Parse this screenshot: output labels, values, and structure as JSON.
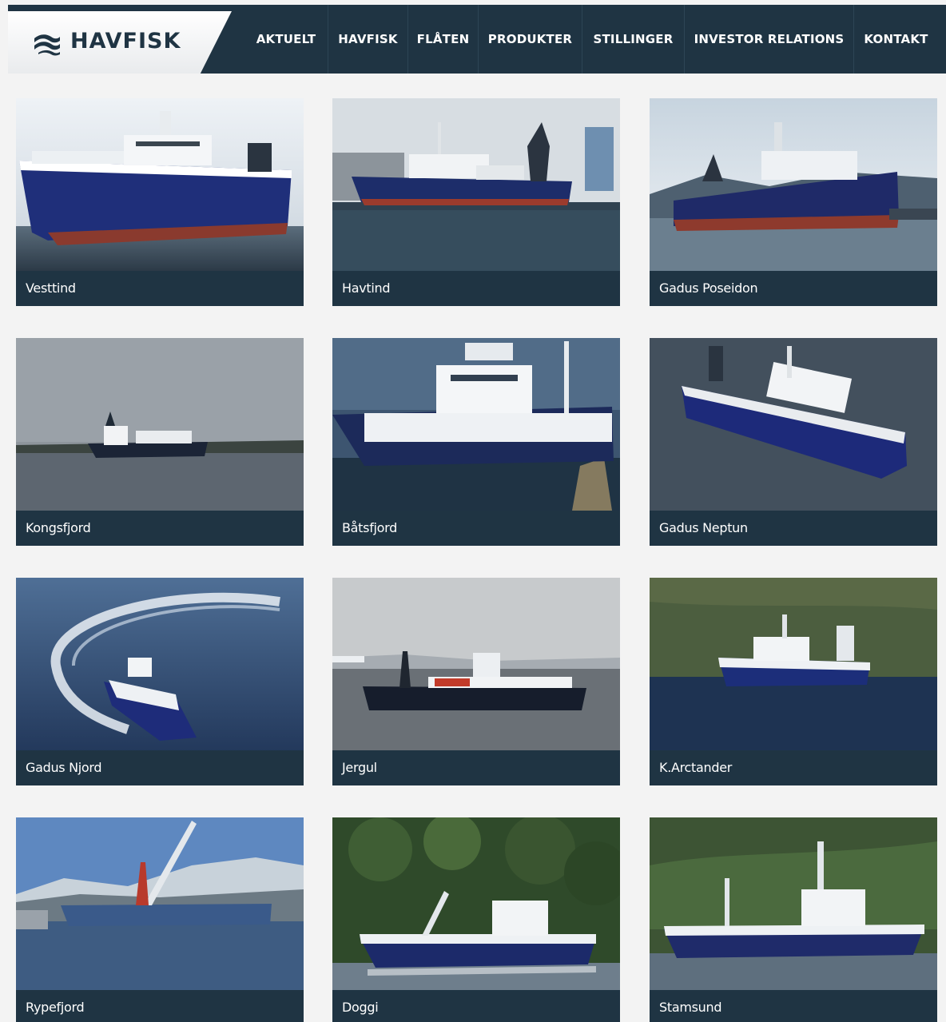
{
  "brand": {
    "name": "HAVFISK",
    "logo_icon": "wave-icon",
    "colors": {
      "navy": "#1f3443",
      "hull_blue": "#1f2f7a",
      "background": "#f3f3f3"
    }
  },
  "nav": {
    "items": [
      {
        "label": "AKTUELT"
      },
      {
        "label": "HAVFISK"
      },
      {
        "label": "FLÅTEN"
      },
      {
        "label": "PRODUKTER"
      },
      {
        "label": "STILLINGER"
      },
      {
        "label": "INVESTOR RELATIONS"
      },
      {
        "label": "KONTAKT"
      }
    ]
  },
  "fleet": {
    "vessels": [
      {
        "name": "Vesttind"
      },
      {
        "name": "Havtind"
      },
      {
        "name": "Gadus Poseidon"
      },
      {
        "name": "Kongsfjord"
      },
      {
        "name": "Båtsfjord"
      },
      {
        "name": "Gadus Neptun"
      },
      {
        "name": "Gadus Njord"
      },
      {
        "name": "Jergul"
      },
      {
        "name": "K.Arctander"
      },
      {
        "name": "Rypefjord"
      },
      {
        "name": "Doggi"
      },
      {
        "name": "Stamsund"
      }
    ]
  }
}
